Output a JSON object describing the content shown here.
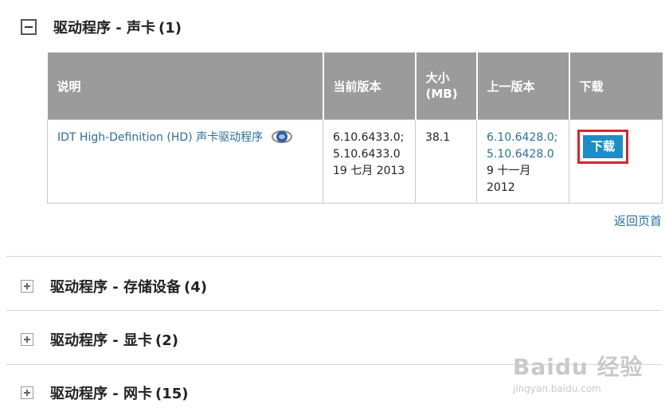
{
  "sections": [
    {
      "title": "驱动程序 - 声卡",
      "count": "(1)",
      "expanded": true
    },
    {
      "title": "驱动程序 - 存储设备",
      "count": "(4)",
      "expanded": false
    },
    {
      "title": "驱动程序 - 显卡",
      "count": "(2)",
      "expanded": false
    },
    {
      "title": "驱动程序 - 网卡",
      "count": "(15)",
      "expanded": false
    }
  ],
  "table": {
    "headers": {
      "desc": "说明",
      "current": "当前版本",
      "size_line1": "大小",
      "size_line2": "(MB)",
      "previous": "上一版本",
      "download": "下载"
    },
    "rows": [
      {
        "desc": "IDT High-Definition (HD) 声卡驱动程序",
        "current_version_1": "6.10.6433.0;",
        "current_version_2": "5.10.6433.0",
        "current_date": "19 七月 2013",
        "size": "38.1",
        "previous_version_1": "6.10.6428.0;",
        "previous_version_2": "5.10.6428.0",
        "previous_date_1": "9 十一月",
        "previous_date_2": "2012",
        "download_label": "下载"
      }
    ]
  },
  "back_to_top": "返回页首",
  "watermark": {
    "logo": "Baidu 经验",
    "url": "jingyan.baidu.com"
  },
  "colors": {
    "header_bg": "#9b9b9b",
    "link": "#2a6f9e",
    "button": "#1b8ec7",
    "highlight": "#d9242b"
  },
  "icons": {
    "collapse": "minus-box-icon",
    "expand": "plus-box-icon",
    "browser": "internet-explorer-icon"
  }
}
